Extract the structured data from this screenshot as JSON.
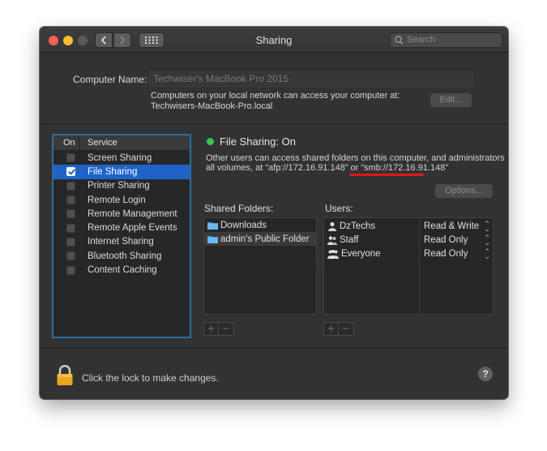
{
  "window": {
    "title": "Sharing",
    "search_placeholder": "Search",
    "icons": {
      "back": "chevron-left-icon",
      "forward": "chevron-right-icon",
      "grid": "show-all-grid-icon",
      "search": "search-icon"
    }
  },
  "computer_name": {
    "label": "Computer Name:",
    "value": "Techwiser's MacBook Pro 2015",
    "info_line1": "Computers on your local network can access your computer at:",
    "info_line2": "Techwisers-MacBook-Pro.local",
    "edit_label": "Edit..."
  },
  "services": {
    "header_on": "On",
    "header_service": "Service",
    "items": [
      {
        "label": "Screen Sharing",
        "checked": false,
        "selected": false
      },
      {
        "label": "File Sharing",
        "checked": true,
        "selected": true
      },
      {
        "label": "Printer Sharing",
        "checked": false,
        "selected": false
      },
      {
        "label": "Remote Login",
        "checked": false,
        "selected": false
      },
      {
        "label": "Remote Management",
        "checked": false,
        "selected": false
      },
      {
        "label": "Remote Apple Events",
        "checked": false,
        "selected": false
      },
      {
        "label": "Internet Sharing",
        "checked": false,
        "selected": false
      },
      {
        "label": "Bluetooth Sharing",
        "checked": false,
        "selected": false
      },
      {
        "label": "Content Caching",
        "checked": false,
        "selected": false
      }
    ]
  },
  "detail": {
    "status": "File Sharing: On",
    "status_color": "#39c84d",
    "desc_line1": "Other users can access shared folders on this computer, and administrators",
    "desc_line2": "all volumes, at “afp://172.16.91.148” or “smb://172.16.91.148”",
    "options_label": "Options...",
    "shared_folders_label": "Shared Folders:",
    "users_label": "Users:",
    "shared_folders": [
      "Downloads",
      "admin's Public Folder"
    ],
    "users": [
      {
        "name": "DzTechs",
        "permission": "Read & Write",
        "icon": "single-user-icon"
      },
      {
        "name": "Staff",
        "permission": "Read Only",
        "icon": "group-icon"
      },
      {
        "name": "Everyone",
        "permission": "Read Only",
        "icon": "everyone-group-icon"
      }
    ],
    "add_symbol": "+",
    "remove_symbol": "−"
  },
  "footer": {
    "lock_text": "Click the lock to make changes.",
    "help_symbol": "?"
  },
  "colors": {
    "selection": "#1f63c9",
    "focus_ring": "#2f6e9e",
    "annotation_red": "#e0161e"
  }
}
